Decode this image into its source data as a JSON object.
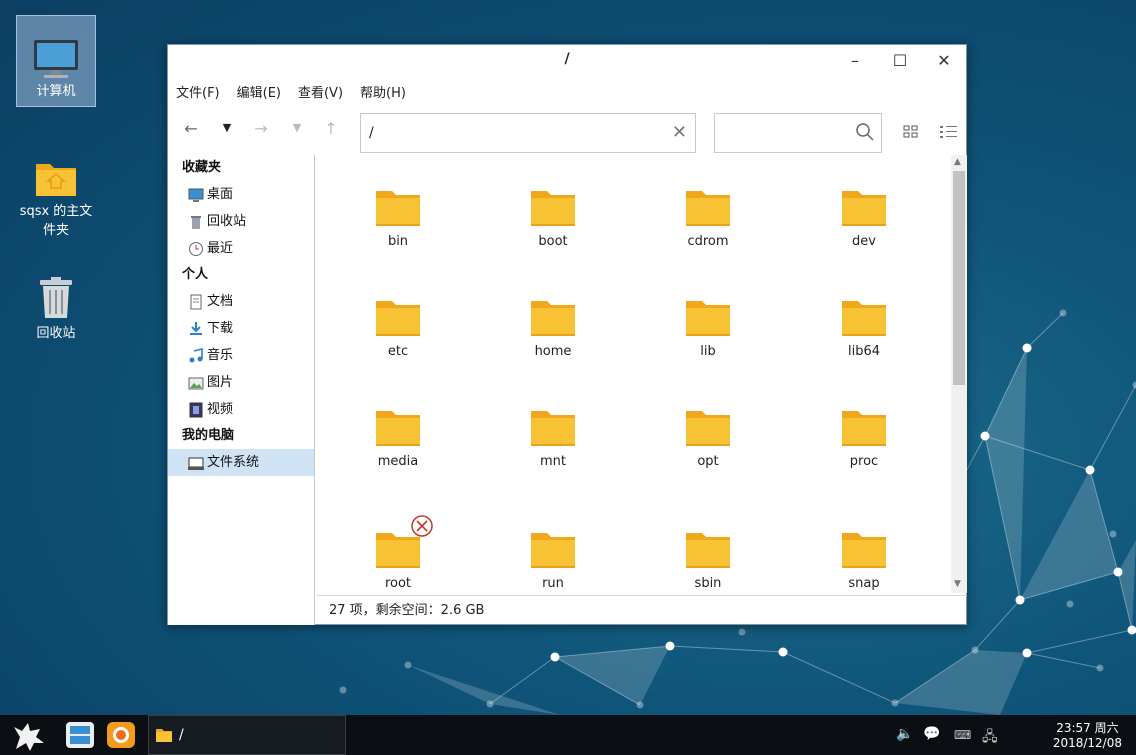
{
  "desktop": {
    "icons": [
      {
        "label": "计算机",
        "selected": true
      },
      {
        "label": "sqsx 的主文件夹"
      },
      {
        "label": "回收站"
      }
    ]
  },
  "window": {
    "title": "/",
    "menu": [
      "文件(F)",
      "编辑(E)",
      "查看(V)",
      "帮助(H)"
    ],
    "path": "/",
    "search_placeholder": "",
    "sidebar": {
      "sections": [
        {
          "header": "收藏夹",
          "items": [
            "桌面",
            "回收站",
            "最近"
          ]
        },
        {
          "header": "个人",
          "items": [
            "文档",
            "下载",
            "音乐",
            "图片",
            "视频"
          ]
        },
        {
          "header": "我的电脑",
          "items": [
            "文件系统"
          ]
        }
      ],
      "active_item": "文件系统"
    },
    "files": [
      {
        "name": "bin"
      },
      {
        "name": "boot"
      },
      {
        "name": "cdrom"
      },
      {
        "name": "dev"
      },
      {
        "name": "etc"
      },
      {
        "name": "home"
      },
      {
        "name": "lib"
      },
      {
        "name": "lib64"
      },
      {
        "name": "media"
      },
      {
        "name": "mnt"
      },
      {
        "name": "opt"
      },
      {
        "name": "proc"
      },
      {
        "name": "root",
        "badge": "no-access-icon"
      },
      {
        "name": "run"
      },
      {
        "name": "sbin"
      },
      {
        "name": "snap"
      }
    ],
    "status": "27 项，剩余空间：2.6 GB"
  },
  "taskbar": {
    "active_window_title": "/",
    "clock_time": "23:57 周六",
    "clock_date": "2018/12/08"
  },
  "colors": {
    "folder": "#f7c233",
    "folder_dark": "#f0a81a",
    "selection": "#cfe3f5"
  }
}
